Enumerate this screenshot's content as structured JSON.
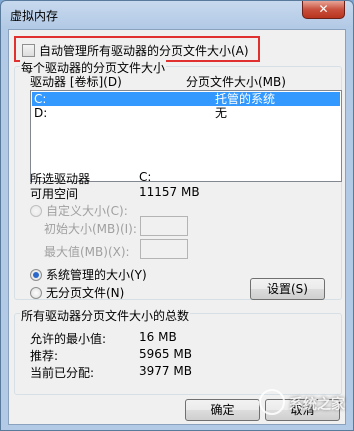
{
  "window": {
    "title": "虚拟内存",
    "close_symbol": "✕"
  },
  "auto_manage": {
    "label": "自动管理所有驱动器的分页文件大小(A)",
    "checked": false
  },
  "per_drive": {
    "group_title": "每个驱动器的分页文件大小",
    "col_drive": "驱动器 [卷标](D)",
    "col_size": "分页文件大小(MB)",
    "rows": [
      {
        "drive": "C:",
        "size": "托管的系统",
        "selected": true
      },
      {
        "drive": "D:",
        "size": "无",
        "selected": false
      }
    ],
    "selected_drive_label": "所选驱动器",
    "selected_drive_value": "C:",
    "free_space_label": "可用空间",
    "free_space_value": "11157 MB",
    "custom_size_label": "自定义大小(C):",
    "initial_size_label": "初始大小(MB)(I):",
    "max_size_label": "最大值(MB)(X):",
    "system_managed_label": "系统管理的大小(Y)",
    "no_paging_label": "无分页文件(N)",
    "set_button": "设置(S)"
  },
  "totals": {
    "group_title": "所有驱动器分页文件大小的总数",
    "min_label": "允许的最小值:",
    "min_value": "16 MB",
    "recommended_label": "推荐:",
    "recommended_value": "5965 MB",
    "current_label": "当前已分配:",
    "current_value": "3977 MB"
  },
  "buttons": {
    "ok": "确定",
    "cancel": "取消"
  },
  "watermark": {
    "text": "系统之家"
  },
  "colors": {
    "highlight": "#e03030",
    "selection": "#3399ff"
  }
}
